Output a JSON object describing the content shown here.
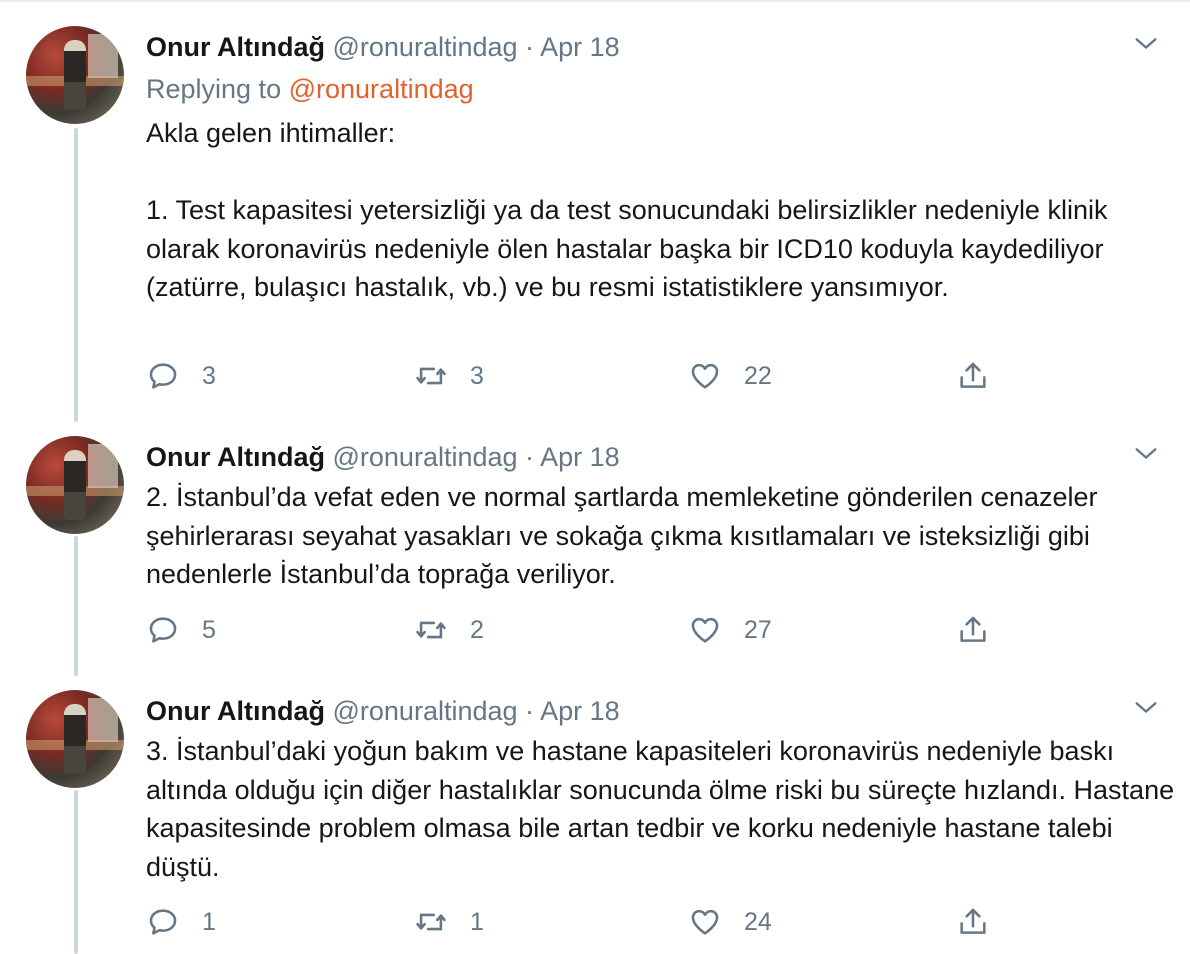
{
  "tweets": [
    {
      "name": "Onur Altındağ",
      "handle": "@ronuraltindag",
      "separator": "·",
      "date": "Apr 18",
      "replying_prefix": "Replying to",
      "replying_handle": "@ronuraltindag",
      "text": "Akla gelen ihtimaller:\n\n1. Test kapasitesi yetersizliği ya da test sonucundaki belirsizlikler nedeniyle klinik olarak koronavirüs nedeniyle ölen hastalar başka bir ICD10 koduyla kaydediliyor (zatürre, bulaşıcı hastalık, vb.) ve bu resmi istatistiklere yansımıyor.",
      "replies": "3",
      "retweets": "3",
      "likes": "22"
    },
    {
      "name": "Onur Altındağ",
      "handle": "@ronuraltindag",
      "separator": "·",
      "date": "Apr 18",
      "text": "2. İstanbul’da vefat eden ve normal şartlarda memleketine gönderilen cenazeler şehirlerarası seyahat yasakları ve sokağa çıkma kısıtlamaları ve isteksizliği gibi nedenlerle İstanbul’da toprağa veriliyor.",
      "replies": "5",
      "retweets": "2",
      "likes": "27"
    },
    {
      "name": "Onur Altındağ",
      "handle": "@ronuraltindag",
      "separator": "·",
      "date": "Apr 18",
      "text": "3. İstanbul’daki yoğun bakım ve hastane kapasiteleri koronavirüs nedeniyle baskı altında olduğu için diğer hastalıklar sonucunda ölme riski bu süreçte hızlandı. Hastane kapasitesinde problem olmasa bile artan tedbir ve korku nedeniyle hastane talebi düştü.",
      "replies": "1",
      "retweets": "1",
      "likes": "24"
    }
  ],
  "icons": {
    "reply": "reply-icon",
    "retweet": "retweet-icon",
    "like": "heart-icon",
    "share": "share-icon",
    "menu": "chevron-down-icon"
  },
  "colors": {
    "text": "#14171a",
    "muted": "#657786",
    "link": "#e0632e",
    "thread_line": "#ccd6dd"
  }
}
